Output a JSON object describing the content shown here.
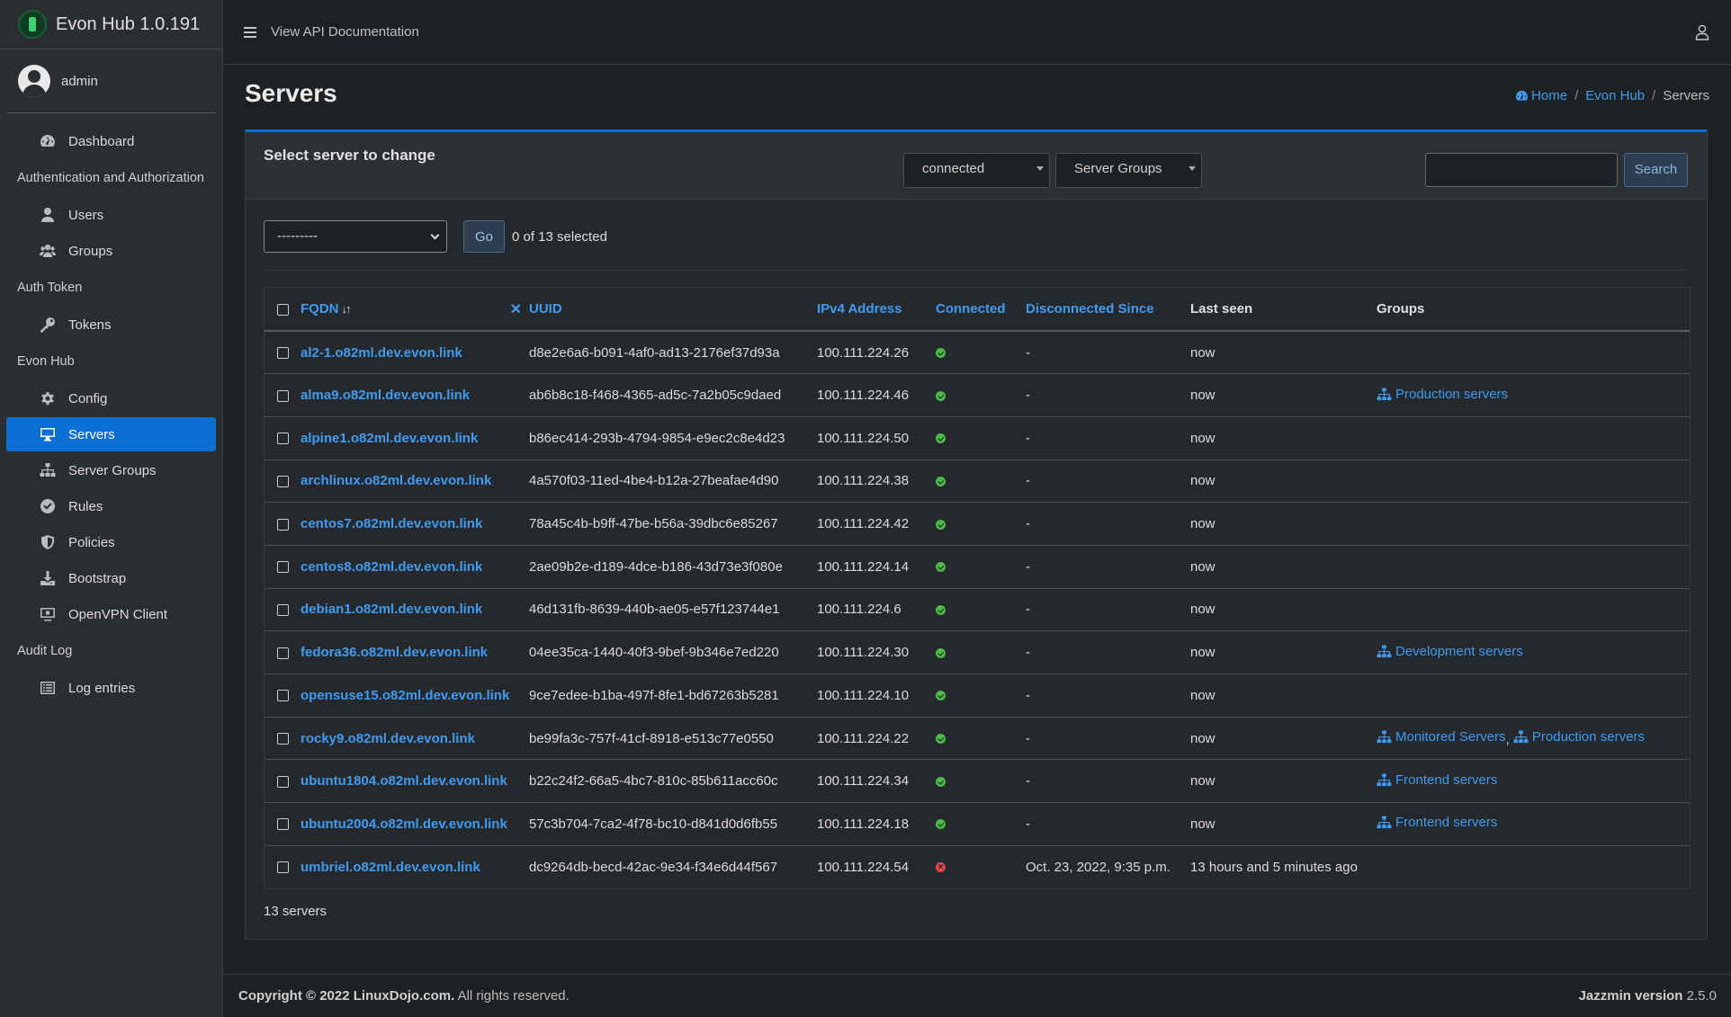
{
  "brand": {
    "title": "Evon Hub 1.0.191"
  },
  "user": {
    "name": "admin"
  },
  "sidebar": {
    "sections": [
      {
        "type": "item",
        "label": "Dashboard",
        "icon": "dashboard-icon"
      },
      {
        "type": "header",
        "label": "Authentication and Authorization"
      },
      {
        "type": "item",
        "label": "Users",
        "icon": "user-icon"
      },
      {
        "type": "item",
        "label": "Groups",
        "icon": "users-icon"
      },
      {
        "type": "header",
        "label": "Auth Token"
      },
      {
        "type": "item",
        "label": "Tokens",
        "icon": "key-icon"
      },
      {
        "type": "header",
        "label": "Evon Hub"
      },
      {
        "type": "item",
        "label": "Config",
        "icon": "gear-icon"
      },
      {
        "type": "item",
        "label": "Servers",
        "icon": "desktop-icon",
        "active": true
      },
      {
        "type": "item",
        "label": "Server Groups",
        "icon": "sitemap-icon"
      },
      {
        "type": "item",
        "label": "Rules",
        "icon": "check-circle-icon"
      },
      {
        "type": "item",
        "label": "Policies",
        "icon": "shield-icon"
      },
      {
        "type": "item",
        "label": "Bootstrap",
        "icon": "download-icon"
      },
      {
        "type": "item",
        "label": "OpenVPN Client",
        "icon": "vpn-client-icon"
      },
      {
        "type": "header",
        "label": "Audit Log"
      },
      {
        "type": "item",
        "label": "Log entries",
        "icon": "list-icon"
      }
    ]
  },
  "topbar": {
    "api_docs_label": "View API Documentation"
  },
  "page": {
    "title": "Servers"
  },
  "breadcrumb": {
    "home": "Home",
    "app": "Evon Hub",
    "current": "Servers"
  },
  "card": {
    "title": "Select server to change",
    "filter_connected": "connected",
    "filter_groups": "Server Groups",
    "search_value": "",
    "search_button": "Search"
  },
  "actions": {
    "select_value": "---------",
    "go_label": "Go",
    "selected_text": "0 of 13 selected"
  },
  "table": {
    "headers": {
      "fqdn": "FQDN",
      "uuid": "UUID",
      "ipv4": "IPv4 Address",
      "connected": "Connected",
      "disconnected_since": "Disconnected Since",
      "last_seen": "Last seen",
      "groups": "Groups"
    },
    "rows": [
      {
        "fqdn": "al2-1.o82ml.dev.evon.link",
        "uuid": "d8e2e6a6-b091-4af0-ad13-2176ef37d93a",
        "ipv4": "100.111.224.26",
        "connected": true,
        "disconnected_since": "-",
        "last_seen": "now",
        "groups": []
      },
      {
        "fqdn": "alma9.o82ml.dev.evon.link",
        "uuid": "ab6b8c18-f468-4365-ad5c-7a2b05c9daed",
        "ipv4": "100.111.224.46",
        "connected": true,
        "disconnected_since": "-",
        "last_seen": "now",
        "groups": [
          "Production servers"
        ]
      },
      {
        "fqdn": "alpine1.o82ml.dev.evon.link",
        "uuid": "b86ec414-293b-4794-9854-e9ec2c8e4d23",
        "ipv4": "100.111.224.50",
        "connected": true,
        "disconnected_since": "-",
        "last_seen": "now",
        "groups": []
      },
      {
        "fqdn": "archlinux.o82ml.dev.evon.link",
        "uuid": "4a570f03-11ed-4be4-b12a-27beafae4d90",
        "ipv4": "100.111.224.38",
        "connected": true,
        "disconnected_since": "-",
        "last_seen": "now",
        "groups": []
      },
      {
        "fqdn": "centos7.o82ml.dev.evon.link",
        "uuid": "78a45c4b-b9ff-47be-b56a-39dbc6e85267",
        "ipv4": "100.111.224.42",
        "connected": true,
        "disconnected_since": "-",
        "last_seen": "now",
        "groups": []
      },
      {
        "fqdn": "centos8.o82ml.dev.evon.link",
        "uuid": "2ae09b2e-d189-4dce-b186-43d73e3f080e",
        "ipv4": "100.111.224.14",
        "connected": true,
        "disconnected_since": "-",
        "last_seen": "now",
        "groups": []
      },
      {
        "fqdn": "debian1.o82ml.dev.evon.link",
        "uuid": "46d131fb-8639-440b-ae05-e57f123744e1",
        "ipv4": "100.111.224.6",
        "connected": true,
        "disconnected_since": "-",
        "last_seen": "now",
        "groups": []
      },
      {
        "fqdn": "fedora36.o82ml.dev.evon.link",
        "uuid": "04ee35ca-1440-40f3-9bef-9b346e7ed220",
        "ipv4": "100.111.224.30",
        "connected": true,
        "disconnected_since": "-",
        "last_seen": "now",
        "groups": [
          "Development servers"
        ]
      },
      {
        "fqdn": "opensuse15.o82ml.dev.evon.link",
        "uuid": "9ce7edee-b1ba-497f-8fe1-bd67263b5281",
        "ipv4": "100.111.224.10",
        "connected": true,
        "disconnected_since": "-",
        "last_seen": "now",
        "groups": []
      },
      {
        "fqdn": "rocky9.o82ml.dev.evon.link",
        "uuid": "be99fa3c-757f-41cf-8918-e513c77e0550",
        "ipv4": "100.111.224.22",
        "connected": true,
        "disconnected_since": "-",
        "last_seen": "now",
        "groups": [
          "Monitored Servers",
          "Production servers"
        ]
      },
      {
        "fqdn": "ubuntu1804.o82ml.dev.evon.link",
        "uuid": "b22c24f2-66a5-4bc7-810c-85b611acc60c",
        "ipv4": "100.111.224.34",
        "connected": true,
        "disconnected_since": "-",
        "last_seen": "now",
        "groups": [
          "Frontend servers"
        ]
      },
      {
        "fqdn": "ubuntu2004.o82ml.dev.evon.link",
        "uuid": "57c3b704-7ca2-4f78-bc10-d841d0d6fb55",
        "ipv4": "100.111.224.18",
        "connected": true,
        "disconnected_since": "-",
        "last_seen": "now",
        "groups": [
          "Frontend servers"
        ]
      },
      {
        "fqdn": "umbriel.o82ml.dev.evon.link",
        "uuid": "dc9264db-becd-42ac-9e34-f34e6d44f567",
        "ipv4": "100.111.224.54",
        "connected": false,
        "disconnected_since": "Oct. 23, 2022, 9:35 p.m.",
        "last_seen": "13 hours and 5 minutes ago",
        "groups": []
      }
    ]
  },
  "summary": {
    "count_text": "13 servers"
  },
  "footer": {
    "copyright_bold": "Copyright © 2022 LinuxDojo.com.",
    "copyright_rest": " All rights reserved.",
    "version_bold": "Jazzmin version",
    "version_value": " 2.5.0"
  },
  "colors": {
    "accent": "#0b6fd6",
    "link": "#3f9cf0",
    "success": "#4cbb47",
    "danger": "#e04a4a"
  }
}
